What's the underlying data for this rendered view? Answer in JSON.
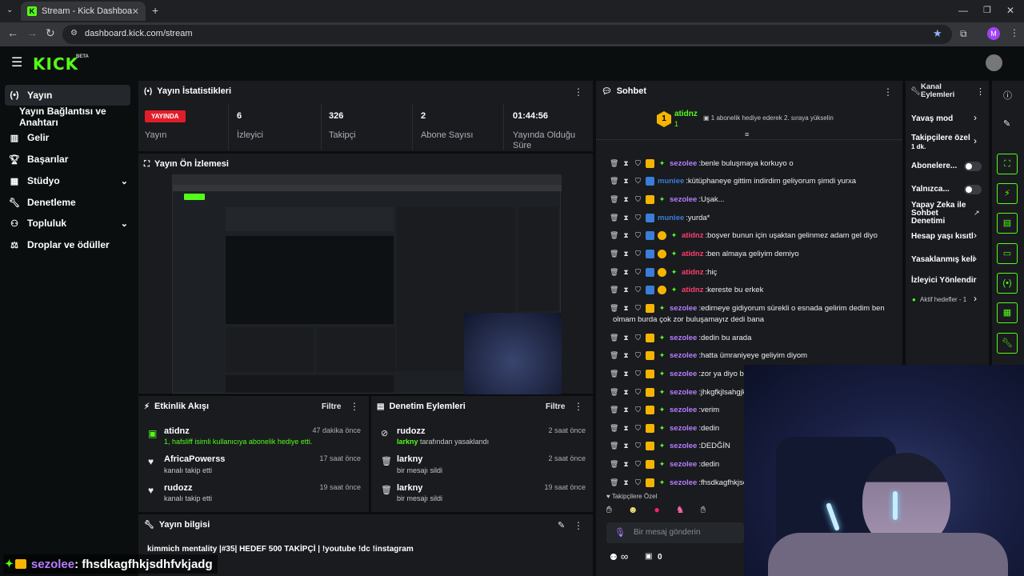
{
  "browser": {
    "tab_title": "Stream - Kick Dashboard",
    "url": "dashboard.kick.com/stream",
    "profile_initial": "M"
  },
  "brand": {
    "logo": "KICK",
    "beta": "BETA",
    "accent": "#53fc18"
  },
  "sidebar": {
    "items": [
      {
        "label": "Yayın",
        "icon": "broadcast-icon"
      },
      {
        "label": "Yayın Bağlantısı ve Anahtarı",
        "icon": ""
      },
      {
        "label": "Gelir",
        "icon": "chart-icon"
      },
      {
        "label": "Başarılar",
        "icon": "trophy-icon"
      },
      {
        "label": "Stüdyo",
        "icon": "studio-icon"
      },
      {
        "label": "Denetleme",
        "icon": "wrench-icon"
      },
      {
        "label": "Topluluk",
        "icon": "community-icon"
      },
      {
        "label": "Droplar ve ödüller",
        "icon": "drops-icon"
      }
    ]
  },
  "stats": {
    "title": "Yayın İstatistikleri",
    "live_badge": "YAYINDA",
    "live_label": "Yayın",
    "viewers_value": "6",
    "viewers_label": "İzleyici",
    "followers_value": "326",
    "followers_label": "Takipçi",
    "subs_value": "2",
    "subs_label": "Abone Sayısı",
    "uptime_value": "01:44:56",
    "uptime_label": "Yayında Olduğu Süre"
  },
  "preview": {
    "title": "Yayın Ön İzlemesi"
  },
  "activity": {
    "title": "Etkinlik Akışı",
    "filter": "Filtre",
    "items": [
      {
        "name": "atidnz",
        "sub": "1, hafsliff isimli kullanıcıya abonelik hediye etti.",
        "time": "47 dakika önce"
      },
      {
        "name": "AfricaPowerss",
        "sub": "kanalı takip etti",
        "time": "17 saat önce"
      },
      {
        "name": "rudozz",
        "sub": "kanalı takip etti",
        "time": "19 saat önce"
      }
    ]
  },
  "moderation": {
    "title": "Denetim Eylemleri",
    "filter": "Filtre",
    "items": [
      {
        "name": "rudozz",
        "sub_highlight": "larkny",
        "sub": "tarafından yasaklandı",
        "time": "2 saat önce"
      },
      {
        "name": "larkny",
        "sub": "bir mesajı sildi",
        "time": "2 saat önce"
      },
      {
        "name": "larkny",
        "sub": "bir mesajı sildi",
        "time": "19 saat önce"
      }
    ]
  },
  "stream_info": {
    "title": "Yayın bilgisi",
    "text": "kimmich mentality |#35| HEDEF 500 TAKİPÇİ | !youtube !dc !instagram"
  },
  "chat": {
    "title": "Sohbet",
    "pinned_user": "atidnz",
    "pinned_count": "1",
    "pinned_text": "1 abonelik hediye ederek 2. sıraya yükselin",
    "messages": [
      {
        "user": "sezolee",
        "color": "#b77dff",
        "text": "benle buluşmaya korkuyo o"
      },
      {
        "user": "muniee",
        "color": "#3b7dd8",
        "text": "kütüphaneye gittim indirdim geliyorum şimdi yurxa"
      },
      {
        "user": "sezolee",
        "color": "#b77dff",
        "text": "Uşak..."
      },
      {
        "user": "muniee",
        "color": "#3b7dd8",
        "text": "yurda*"
      },
      {
        "user": "atidnz",
        "color": "#ff3d6e",
        "text": "boşver bunun için uşaktan gelinmez adam gel diyo"
      },
      {
        "user": "atidnz",
        "color": "#ff3d6e",
        "text": "ben almaya geliyim demiyo"
      },
      {
        "user": "atidnz",
        "color": "#ff3d6e",
        "text": "hiç"
      },
      {
        "user": "atidnz",
        "color": "#ff3d6e",
        "text": "kereste bu erkek"
      },
      {
        "user": "sezolee",
        "color": "#b77dff",
        "text": "edirneye gidiyorum sürekli o esnada gelirim dedim ben"
      },
      {
        "user": "",
        "color": "#b77dff",
        "text": "olmam burda çok zor buluşamayız dedi bana"
      },
      {
        "user": "sezolee",
        "color": "#b77dff",
        "text": "dedin bu arada"
      },
      {
        "user": "sezolee",
        "color": "#b77dff",
        "text": "hatta ümraniyeye geliyim diyom"
      },
      {
        "user": "sezolee",
        "color": "#b77dff",
        "text": "zor ya diyo ba"
      },
      {
        "user": "sezolee",
        "color": "#b77dff",
        "text": "jhkgfkjlsahgjk"
      },
      {
        "user": "sezolee",
        "color": "#b77dff",
        "text": "verim"
      },
      {
        "user": "sezolee",
        "color": "#b77dff",
        "text": "dedin"
      },
      {
        "user": "sezolee",
        "color": "#b77dff",
        "text": "DEDĞİN"
      },
      {
        "user": "sezolee",
        "color": "#b77dff",
        "text": "dedin"
      },
      {
        "user": "sezolee",
        "color": "#b77dff",
        "text": "fhsdkagfhkjsc"
      }
    ],
    "follower_only": "Takipçilere Özel",
    "input_placeholder": "Bir mesaj gönderin",
    "infinity": "∞",
    "count": "0"
  },
  "channel_actions": {
    "title": "Kanal Eylemleri",
    "slow_mode": "Yavaş mod",
    "followers_only": "Takipçilere özel",
    "followers_only_sub": "1 dk.",
    "subs": "Abonelere...",
    "only": "Yalnızca...",
    "ai": "Yapay Zeka ile Sohbet Denetimi",
    "age": "Hesap yaşı kısıtl",
    "banned": "Yasaklanmış keli",
    "viewer_redirect": "İzleyici Yönlendir",
    "active_goals": "Aktif hedefler - 1"
  },
  "overlay": {
    "user": "sezolee",
    "text": ": fhsdkagfhkjsdhfvkjadg"
  }
}
